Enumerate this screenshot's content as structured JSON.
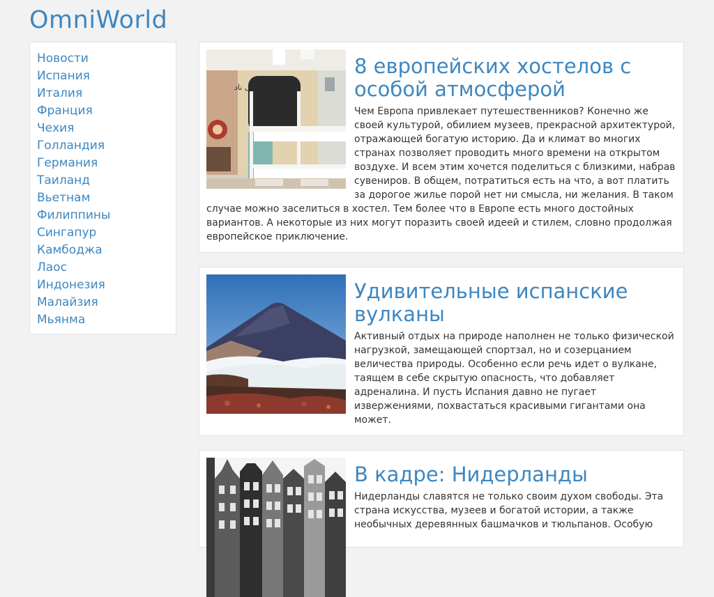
{
  "site": {
    "title": "OmniWorld"
  },
  "sidebar": {
    "items": [
      {
        "label": "Новости"
      },
      {
        "label": "Испания"
      },
      {
        "label": "Италия"
      },
      {
        "label": "Франция"
      },
      {
        "label": "Чехия"
      },
      {
        "label": "Голландия"
      },
      {
        "label": "Германия"
      },
      {
        "label": "Таиланд"
      },
      {
        "label": "Вьетнам"
      },
      {
        "label": "Филиппины"
      },
      {
        "label": "Сингапур"
      },
      {
        "label": "Камбоджа"
      },
      {
        "label": "Лаос"
      },
      {
        "label": "Индонезия"
      },
      {
        "label": "Малайзия"
      },
      {
        "label": "Мьянма"
      }
    ]
  },
  "articles": [
    {
      "title": "8 европейских хостелов с особой атмосферой",
      "text": "Чем Европа привлекает путешественников? Конечно же своей культурой, обилием музеев, прекрасной архитектурой, отражающей богатую историю. Да и климат во многих странах позволяет проводить много времени на открытом воздухе. И всем этим хочется поделиться с близкими, набрав сувениров. В общем, потратиться есть на что, а вот платить за дорогое жилье порой нет ни смысла, ни желания. В таком случае можно заселиться в хостел. Тем более что в Европе есть много достойных вариантов. А некоторые из них могут поразить своей идеей и стилем, словно продолжая европейское приключение.",
      "image_sign": "بيانى ناد"
    },
    {
      "title": "Удивительные испанские вулканы",
      "text": "Активный отдых на природе наполнен не только физической нагрузкой, замещающей спортзал, но и созерцанием величества природы. Особенно если речь идет о вулкане, таящем в себе скрытую опасность, что добавляет адреналина. И пусть Испания давно не пугает извержениями, похвастаться красивыми гигантами она может."
    },
    {
      "title": "В кадре: Нидерланды",
      "text": "Нидерланды славятся не только своим духом свободы. Эта страна искусства, музеев и богатой истории, а также необычных деревянных башмачков и тюльпанов. Особую"
    }
  ],
  "colors": {
    "accent": "#3e87c0",
    "background": "#f2f2f2",
    "card": "#ffffff",
    "text": "#333333"
  }
}
